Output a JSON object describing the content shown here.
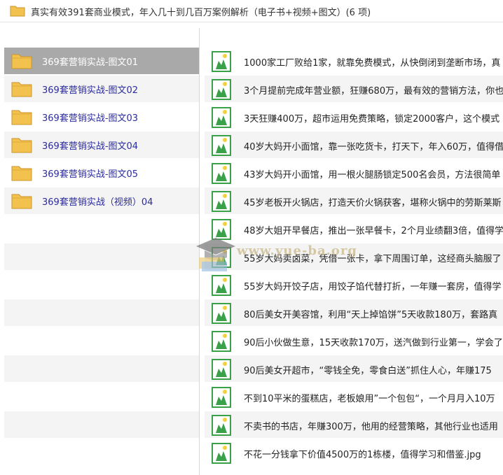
{
  "window": {
    "title": "真实有效391套商业模式，年入几十到几百万案例解析（电子书+视频+图文）(6 项)"
  },
  "folders": [
    {
      "label": "369套营销实战-图文01",
      "selected": true
    },
    {
      "label": "369套营销实战-图文02",
      "selected": false
    },
    {
      "label": "369套营销实战-图文03",
      "selected": false
    },
    {
      "label": "369套营销实战-图文04",
      "selected": false
    },
    {
      "label": "369套营销实战-图文05",
      "selected": false
    },
    {
      "label": "369套营销实战（视频）04",
      "selected": false
    }
  ],
  "files": [
    "1000家工厂败给1家，就靠免费模式，从快倒闭到垄断市场，真",
    "3个月提前完成年营业额，狂赚680万，最有效的营销方法，你也",
    "3天狂赚400万，超市运用免费策略，锁定2000客户，这个模式",
    "40岁大妈开小面馆，靠一张吃货卡，打天下，年入60万，值得借",
    "43岁大妈开小面馆，用一根火腿肠锁定500名会员，方法很简单",
    "45岁老板开火锅店，打造天价火锅获客，堪称火锅中的劳斯莱斯",
    "48岁大姐开早餐店，推出一张早餐卡，2个月业绩翻3倍，值得学",
    "55岁大妈卖卤菜，凭借一张卡，拿下周围订单，这经商头脑服了",
    "55岁大妈开饺子店，用饺子馅代替打折，一年赚一套房，值得学",
    "80后美女开美容馆，利用“天上掉馅饼”5天收款180万，套路真",
    "90后小伙做生意，15天收款170万，送汽做到行业第一，学会了",
    "90后美女开超市，“零钱全免，零食白送”抓住人心，年赚175",
    "不到10平米的蛋糕店，老板娘用”一个包包“，一个月月入10万",
    "不卖书的书店，年赚300万，他用的经营策略，其他行业也适用",
    "不花一分钱拿下价值4500万的1栋楼，值得学习和借鉴.jpg"
  ],
  "watermark": {
    "text": "www.yue-ba.org"
  },
  "colors": {
    "folder": "#f2c14e",
    "selected_row": "#a9a9a9",
    "folder_label": "#2b2b9c",
    "stripe": "#f4f4f4",
    "image_icon_green": "#3aa04a"
  },
  "icons": {
    "folder": "folder-icon",
    "image_file": "image-file-icon"
  }
}
